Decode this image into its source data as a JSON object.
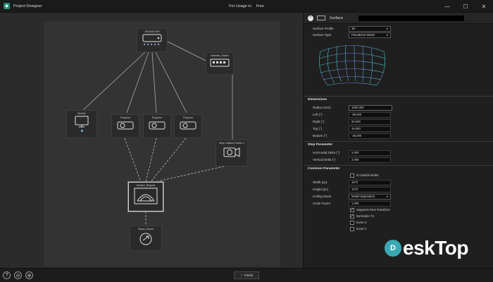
{
  "window": {
    "app_title": "Project Designer",
    "center_title_1": "For Usage in:",
    "center_title_2": "Free",
    "minimize": "—",
    "maximize": "☐",
    "close": "✕"
  },
  "graph": {
    "nodes": {
      "server": "SM-MASTER",
      "switch": "Network_Switch",
      "monitor": "Monitor",
      "projector1": "Projector",
      "projector2": "Projector",
      "projector3": "Projector",
      "camera": "uEye Capture Device 1",
      "surface": "Surface_Regular",
      "export": "Helper_Export"
    }
  },
  "panel": {
    "header_label": "Surface",
    "surface_profile_label": "Surface Profile",
    "surface_profile_value": "3D",
    "surface_type_label": "Surface Type",
    "surface_type_value": "Panadome Model",
    "dimensions": {
      "title": "Dimensions",
      "radius_label": "Radius (mm)",
      "radius_value": "1000,000",
      "left_label": "Left (°)",
      "left_value": "-90,000",
      "right_label": "Right (°)",
      "right_value": "90,000",
      "top_label": "Top (°)",
      "top_value": "45,000",
      "bottom_label": "Bottom (°)",
      "bottom_value": "-45,000"
    },
    "step": {
      "title": "Step Parameter",
      "hdelta_label": "Horizontal Delta (°)",
      "hdelta_value": "2,000",
      "vdelta_label": "Vertical Delta (°)",
      "vdelta_value": "2,000"
    },
    "common": {
      "title": "Common Parameter",
      "is_outside_label": "Is Outside Model",
      "width_label": "Width (px)",
      "width_value": "1072",
      "height_label": "Height (px)",
      "height_value": "1072",
      "culling_label": "Culling Mode",
      "culling_value": "Model Dependent",
      "scale_label": "Scale Factor",
      "scale_value": "1,000",
      "suppress_label": "Suppress Root Transform",
      "normalize_label": "Normalize TC",
      "invert_u_label": "Invert U",
      "invert_v_label": "Invert V"
    }
  },
  "bottom": {
    "help": "?",
    "remove": "⊖",
    "add": "⊕",
    "finish": "Finish"
  },
  "watermark": {
    "text": "eskTop",
    "logo": "D"
  },
  "colors": {
    "accent": "#3aa8b4",
    "mesh": "#3fd0c8",
    "mesh_warm": "#7a6ad8"
  }
}
